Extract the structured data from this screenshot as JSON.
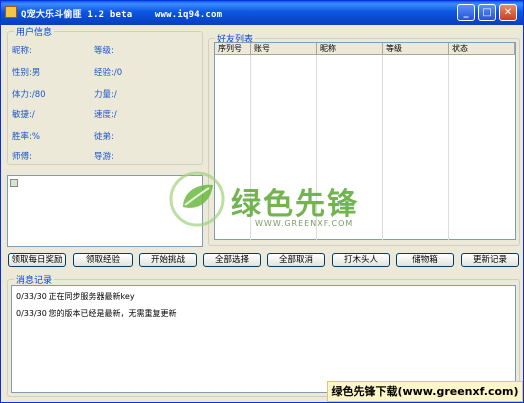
{
  "window": {
    "title": "Q宠大乐斗偷匪 1.2 beta    www.iq94.com",
    "min_symbol": "_",
    "max_symbol": "□",
    "close_symbol": "✕"
  },
  "user_info": {
    "title": "用户信息",
    "fields": [
      {
        "label": "昵称:"
      },
      {
        "label": "等级:"
      },
      {
        "label": "性别:男"
      },
      {
        "label": "经验:/0"
      },
      {
        "label": "体力:/80"
      },
      {
        "label": "力量:/"
      },
      {
        "label": "敏捷:/"
      },
      {
        "label": "速度:/"
      },
      {
        "label": "胜率:%"
      },
      {
        "label": "徒弟:"
      },
      {
        "label": "师傅:"
      },
      {
        "label": "导游:"
      }
    ]
  },
  "friend_list": {
    "title": "好友列表",
    "columns": [
      "序列号",
      "账号",
      "昵称",
      "等级",
      "状态"
    ]
  },
  "buttons": [
    "领取每日奖励",
    "领取经验",
    "开始挑战",
    "全部选择",
    "全部取消",
    "打木头人",
    "储物箱",
    "更新记录"
  ],
  "messages": {
    "title": "消息记录",
    "lines": [
      {
        "time": "0/33/30",
        "text": "正在同步服务器最新key"
      },
      {
        "time": "0/33/30",
        "text": "您的版本已经是最新，无需重复更新"
      }
    ]
  },
  "watermark": {
    "logo_text": "绿色先锋",
    "url": "WWW.GREENXF.COM"
  },
  "footer_banner": "绿色先锋下载(www.greenxf.com)"
}
